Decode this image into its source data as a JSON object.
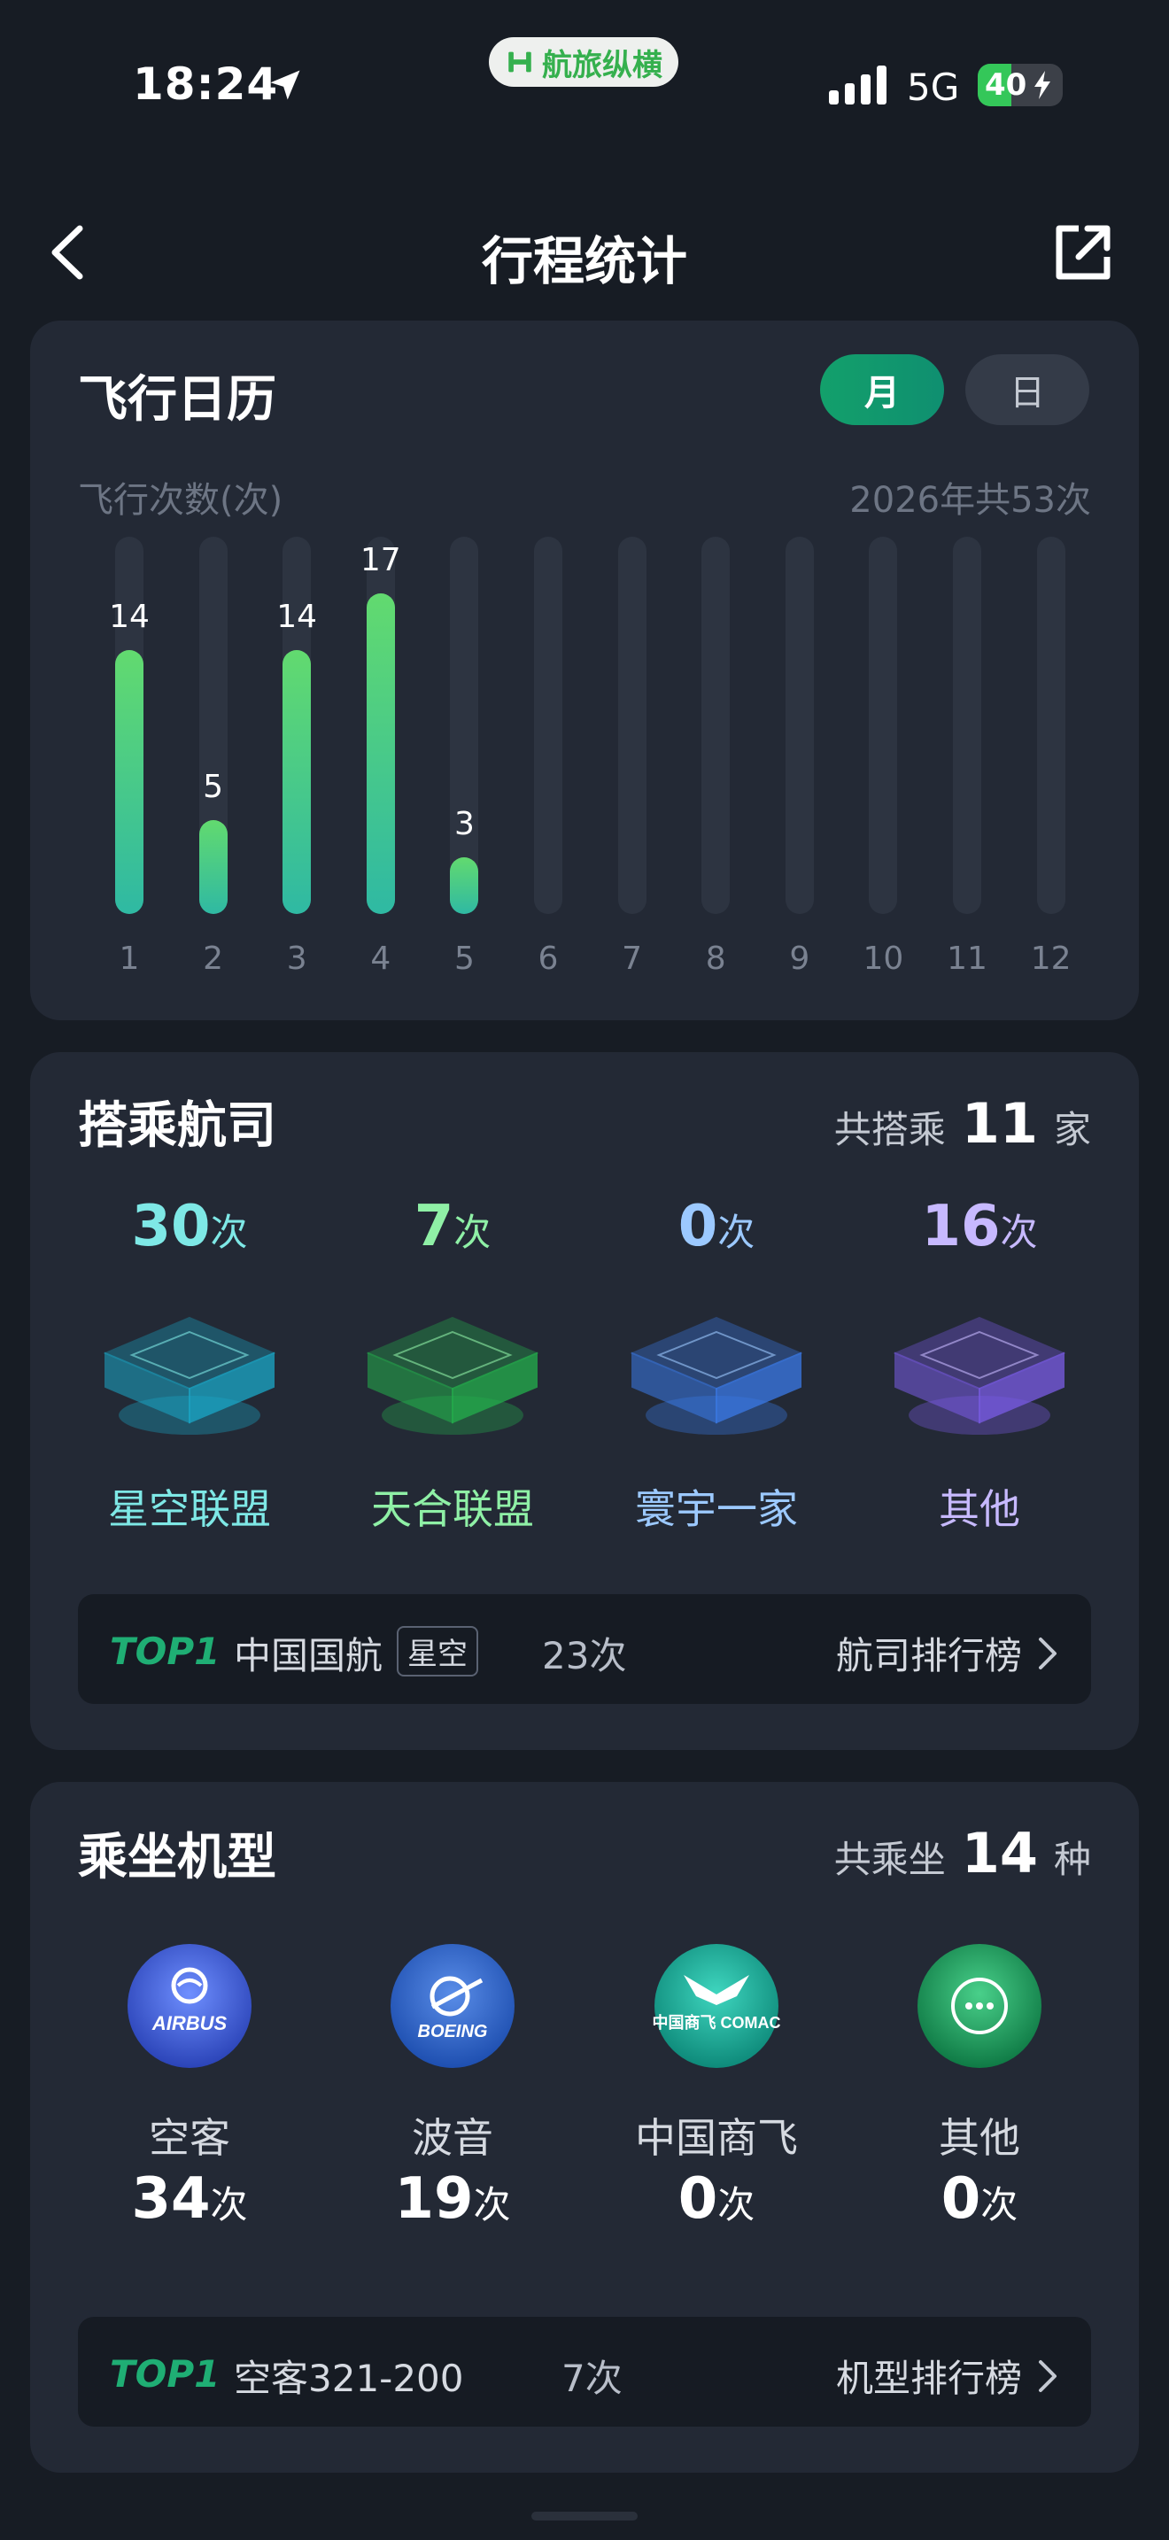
{
  "status_bar": {
    "time": "18:24",
    "app_name": "航旅纵横",
    "network": "5G",
    "battery": "40",
    "battery_fraction": 0.4
  },
  "nav": {
    "title": "行程统计"
  },
  "calendar": {
    "title": "飞行日历",
    "toggle_month": "月",
    "toggle_day": "日",
    "y_label": "飞行次数(次)",
    "total": "2026年共53次"
  },
  "chart_data": {
    "type": "bar",
    "categories": [
      "1",
      "2",
      "3",
      "4",
      "5",
      "6",
      "7",
      "8",
      "9",
      "10",
      "11",
      "12"
    ],
    "values": [
      14,
      5,
      14,
      17,
      3,
      0,
      0,
      0,
      0,
      0,
      0,
      0
    ],
    "ylabel": "飞行次数(次)",
    "ylim": [
      0,
      20
    ],
    "grid": false,
    "colors": {
      "bar_top": "#62da6f",
      "bar_bottom": "#2fb9a3",
      "track": "#2d3441"
    }
  },
  "airline": {
    "title": "搭乘航司",
    "meta_prefix": "共搭乘",
    "meta_count": "11",
    "meta_suffix": "家",
    "alliances": [
      {
        "count": "30",
        "unit": "次",
        "name": "星空联盟",
        "color": "#7ee8e6",
        "cube": "#1aa8c8"
      },
      {
        "count": "7",
        "unit": "次",
        "name": "天合联盟",
        "color": "#8ff0a6",
        "cube": "#24b04c"
      },
      {
        "count": "0",
        "unit": "次",
        "name": "寰宇一家",
        "color": "#9cc9ff",
        "cube": "#3a7ae8"
      },
      {
        "count": "16",
        "unit": "次",
        "name": "其他",
        "color": "#c7b9ff",
        "cube": "#7a5ce6"
      }
    ],
    "top": {
      "badge": "TOP1",
      "name": "中国国航",
      "tag": "星空",
      "count": "23次",
      "link": "航司排行榜"
    }
  },
  "aircraft": {
    "title": "乘坐机型",
    "meta_prefix": "共乘坐",
    "meta_count": "14",
    "meta_suffix": "种",
    "makers": [
      {
        "name": "空客",
        "count": "34",
        "unit": "次",
        "icon": "airbus-logo-icon",
        "logo_text": "AIRBUS",
        "color": "#3a5fd0"
      },
      {
        "name": "波音",
        "count": "19",
        "unit": "次",
        "icon": "boeing-logo-icon",
        "logo_text": "BOEING",
        "color": "#2f63c9"
      },
      {
        "name": "中国商飞",
        "count": "0",
        "unit": "次",
        "icon": "comac-logo-icon",
        "logo_text": "中国商飞 COMAC",
        "color": "#15a08e"
      },
      {
        "name": "其他",
        "count": "0",
        "unit": "次",
        "icon": "more-circle-icon",
        "logo_text": "",
        "color": "#1c9a5c"
      }
    ],
    "top": {
      "badge": "TOP1",
      "name": "空客321-200",
      "count": "7次",
      "link": "机型排行榜"
    }
  }
}
